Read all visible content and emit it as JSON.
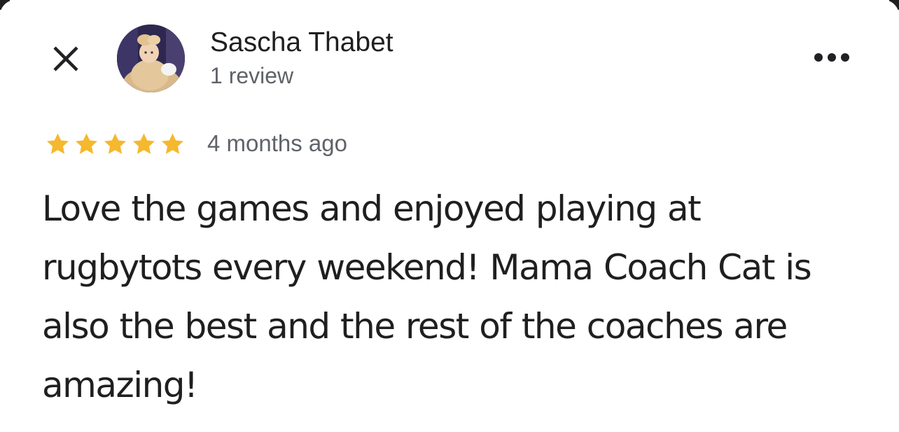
{
  "header": {
    "reviewer_name": "Sascha Thabet",
    "review_count": "1 review",
    "avatar_description": "profile-photo",
    "close_icon": "close-icon",
    "more_icon": "more-horizontal-icon"
  },
  "rating": {
    "stars": 5,
    "max_stars": 5,
    "star_color": "#F5B82E",
    "time_ago": "4 months ago"
  },
  "review": {
    "text": "Love the games and enjoyed playing at rugbytots every weekend! Mama Coach Cat is also the best and the rest of the coaches are amazing!"
  },
  "colors": {
    "primary_text": "#1F1F1F",
    "secondary_text": "#5F6368",
    "background": "#FFFFFF"
  }
}
